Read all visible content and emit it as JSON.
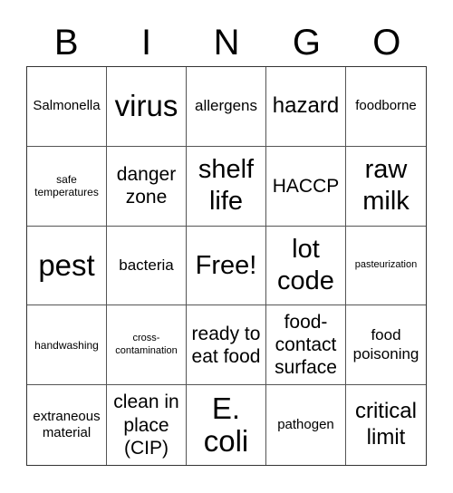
{
  "header": {
    "letters": [
      "B",
      "I",
      "N",
      "G",
      "O"
    ]
  },
  "cells": [
    "Salmonella",
    "virus",
    "allergens",
    "hazard",
    "foodborne",
    "safe temperatures",
    "danger zone",
    "shelf life",
    "HACCP",
    "raw milk",
    "pest",
    "bacteria",
    "Free!",
    "lot code",
    "pasteurization",
    "handwashing",
    "cross-contamination",
    "ready to eat food",
    "food-contact surface",
    "food poisoning",
    "extraneous material",
    "clean in place (CIP)",
    "E. coli",
    "pathogen",
    "critical limit"
  ],
  "free_space": {
    "label": "Free!"
  }
}
